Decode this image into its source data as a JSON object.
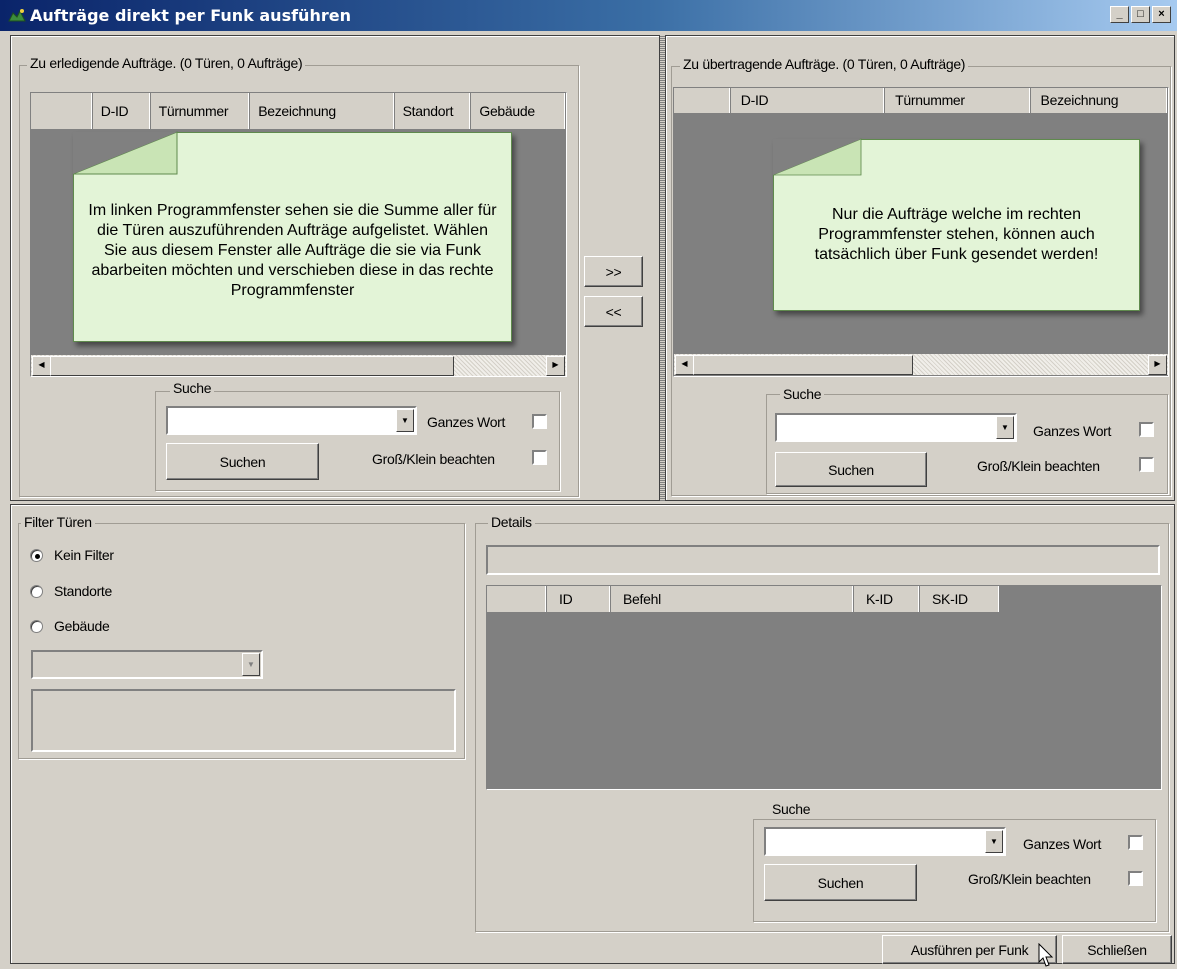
{
  "window": {
    "title": "Aufträge direkt per Funk ausführen",
    "min_label": "_",
    "max_label": "□",
    "close_label": "×"
  },
  "left_panel": {
    "group_label": "Zu erledigende Aufträge. (0 Türen, 0 Aufträge)",
    "columns": [
      "",
      "D-ID",
      "Türnummer",
      "Bezeichnung",
      "Standort",
      "Gebäude"
    ],
    "callout_text": "Im linken Programmfenster sehen sie die Summe aller für die Türen auszuführenden Aufträge aufgelistet. Wählen Sie aus diesem Fenster alle Aufträge die sie via Funk abarbeiten möchten und verschieben diese in das rechte Programmfenster",
    "search": {
      "label": "Suche",
      "button": "Suchen",
      "whole_word": "Ganzes Wort",
      "case": "Groß/Klein beachten"
    }
  },
  "transfer": {
    "right_label": ">>",
    "left_label": "<<"
  },
  "right_panel": {
    "group_label": "Zu übertragende Aufträge. (0 Türen, 0 Aufträge)",
    "columns": [
      "",
      "D-ID",
      "Türnummer",
      "Bezeichnung"
    ],
    "callout_text": "Nur die Aufträge welche im rechten Programmfenster stehen, können auch tatsächlich über Funk gesendet werden!",
    "search": {
      "label": "Suche",
      "button": "Suchen",
      "whole_word": "Ganzes Wort",
      "case": "Groß/Klein beachten"
    }
  },
  "filter": {
    "group_label": "Filter Türen",
    "options": [
      "Kein Filter",
      "Standorte",
      "Gebäude"
    ],
    "selected": "Kein Filter"
  },
  "details": {
    "group_label": "Details",
    "columns": [
      "",
      "ID",
      "Befehl",
      "K-ID",
      "SK-ID"
    ],
    "search": {
      "label": "Suche",
      "button": "Suchen",
      "whole_word": "Ganzes Wort",
      "case": "Groß/Klein beachten"
    }
  },
  "footer": {
    "execute_label": "Ausführen per Funk",
    "close_label": "Schließen"
  },
  "colors": {
    "titlebar_start": "#0a246a",
    "titlebar_end": "#a6caf0",
    "callout_bg": "#e3f4d7",
    "list_bg": "#808080"
  }
}
